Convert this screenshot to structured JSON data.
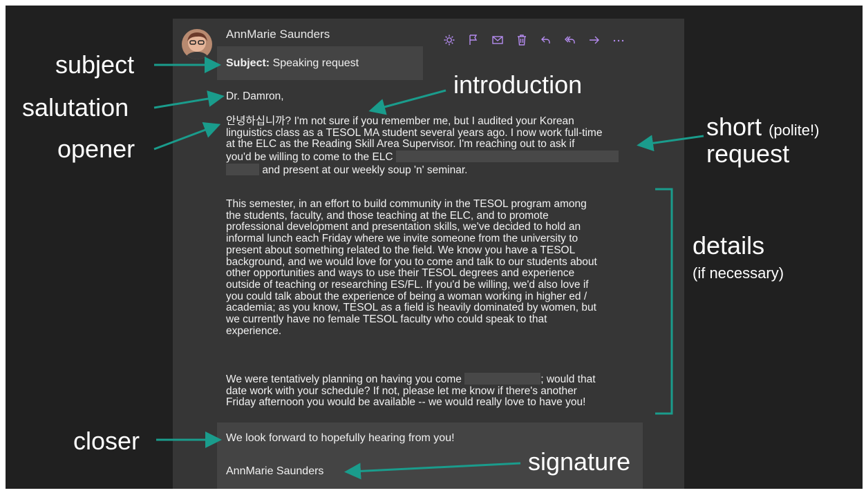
{
  "email": {
    "sender": "AnnMarie Saunders",
    "subject_label": "Subject:",
    "subject_value": "Speaking request",
    "salutation": "Dr. Damron,",
    "opener_lines": [
      "안녕하십니까? I'm not sure if you remember me, but I audited your Korean",
      "linguistics class as a TESOL MA student several years ago. I now work full-time",
      "at the ELC as the Reading Skill Area Supervisor. I'm reaching out to ask if",
      "you'd be willing to come to the ELC",
      "and present at our weekly soup 'n' seminar."
    ],
    "details_lines": [
      "This semester, in an effort to build community in the TESOL program among",
      "the students, faculty, and those teaching at the ELC, and to promote",
      "professional development and presentation skills, we've decided to hold an",
      "informal lunch each Friday where we invite someone from the university to",
      "present about something related to the field. We know you have a TESOL",
      "background, and we would love for you to come and talk to our students about",
      "other opportunities and ways to use their TESOL degrees and experience",
      "outside of teaching or researching ES/FL. If you'd be willing, we'd also love if",
      "you could talk about the experience of being a woman working in higher ed /",
      "academia; as you know, TESOL as a field is heavily dominated by women, but",
      "we currently have no female TESOL faculty who could speak to that",
      "experience."
    ],
    "schedule_lines": [
      "We were tentatively planning on having you come",
      "; would that",
      "date work with your schedule? If not, please let me know if there's another",
      "Friday afternoon you would be available -- we would really love to have you!"
    ],
    "closing": "We look forward to hopefully hearing from you!",
    "signature": "AnnMarie Saunders"
  },
  "annotations": {
    "subject": "subject",
    "salutation": "salutation",
    "opener": "opener",
    "introduction": "introduction",
    "short": "short",
    "polite": "(polite!)",
    "request": "request",
    "details": "details",
    "if_necessary": "(if necessary)",
    "closer": "closer",
    "signature": "signature"
  },
  "colors": {
    "arrow": "#1a9c8c",
    "toolbar_icon": "#b58cf0",
    "slide_bg": "#202020",
    "email_bg": "#363636"
  },
  "toolbar_icons": [
    "sun-icon",
    "flag-icon",
    "mail-icon",
    "trash-icon",
    "reply-icon",
    "reply-all-icon",
    "forward-icon",
    "more-icon"
  ]
}
